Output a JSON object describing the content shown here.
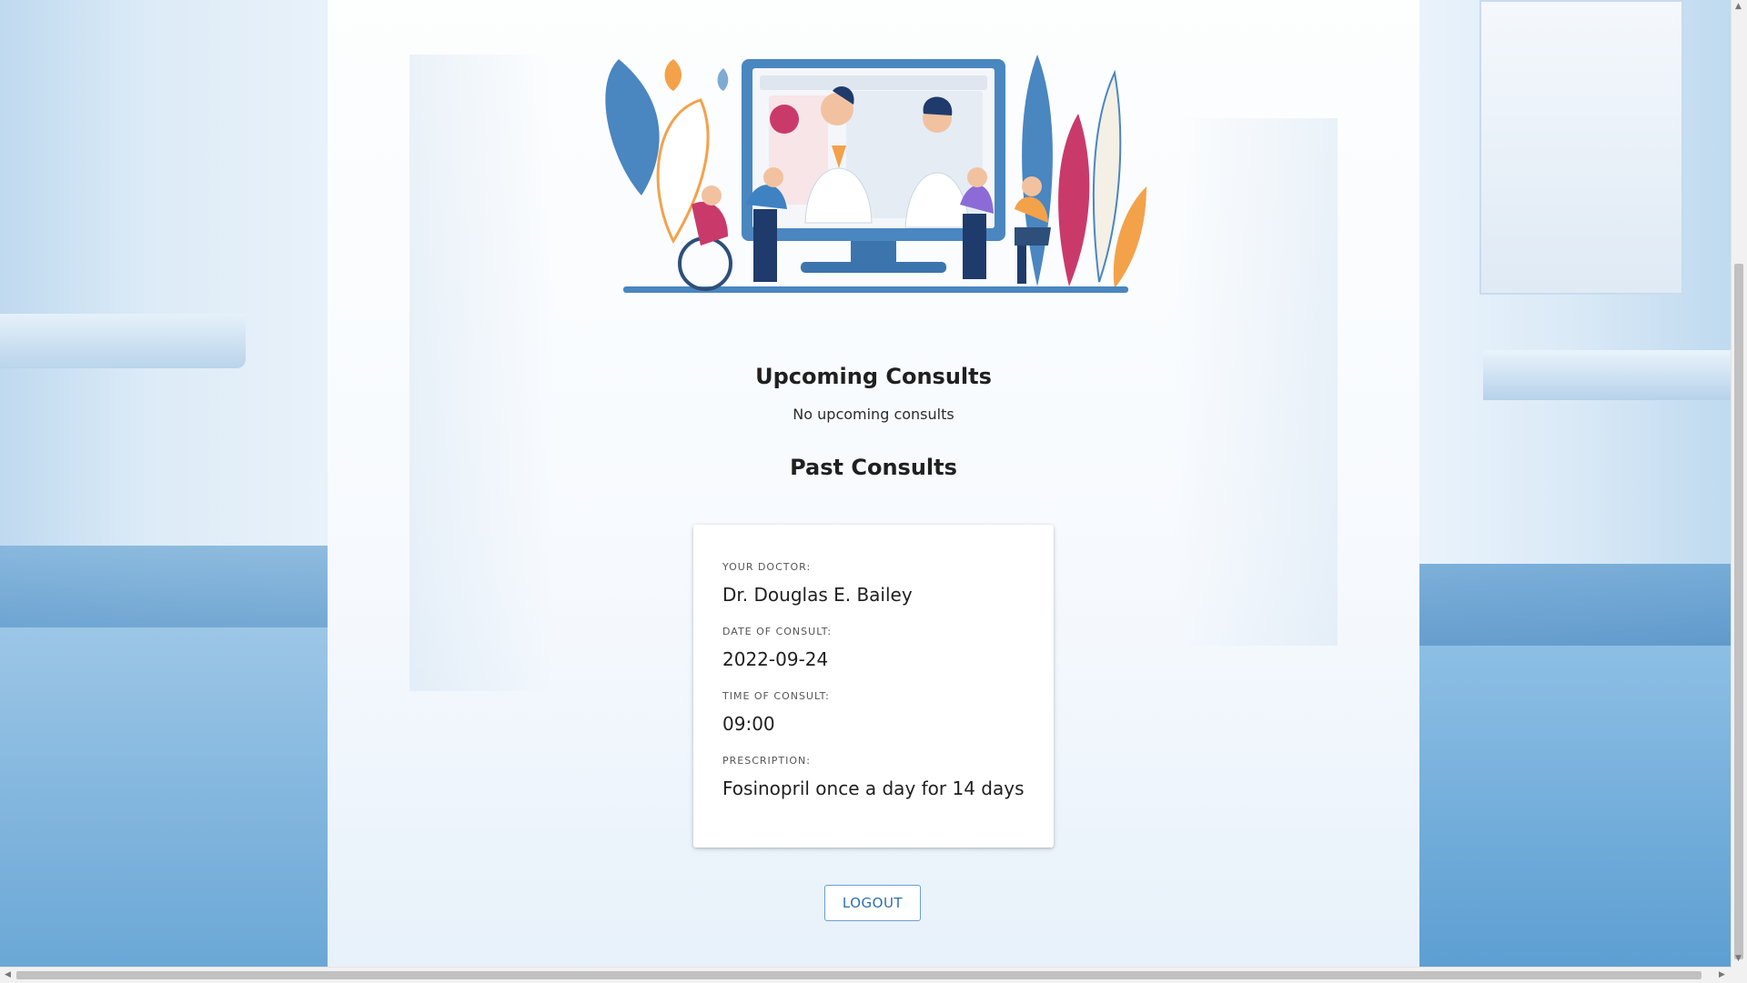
{
  "upcoming": {
    "title": "Upcoming Consults",
    "empty_message": "No upcoming consults"
  },
  "past": {
    "title": "Past Consults",
    "consults": [
      {
        "doctor_label": "YOUR DOCTOR:",
        "doctor": "Dr. Douglas E. Bailey",
        "date_label": "DATE OF CONSULT:",
        "date": "2022-09-24",
        "time_label": "TIME OF CONSULT:",
        "time": "09:00",
        "prescription_label": "PRESCRIPTION:",
        "prescription": "Fosinopril once a day for 14 days"
      }
    ]
  },
  "logout_label": "LOGOUT",
  "colors": {
    "accent": "#2b6fb0",
    "button_border": "#6a9fcf",
    "illustration_blue": "#4a86c0",
    "illustration_pink": "#c93a6b",
    "illustration_orange": "#f3a24a"
  },
  "icons": {
    "scroll_left": "triangle-left",
    "scroll_right": "triangle-right",
    "scroll_up": "triangle-up",
    "scroll_down": "triangle-down"
  }
}
